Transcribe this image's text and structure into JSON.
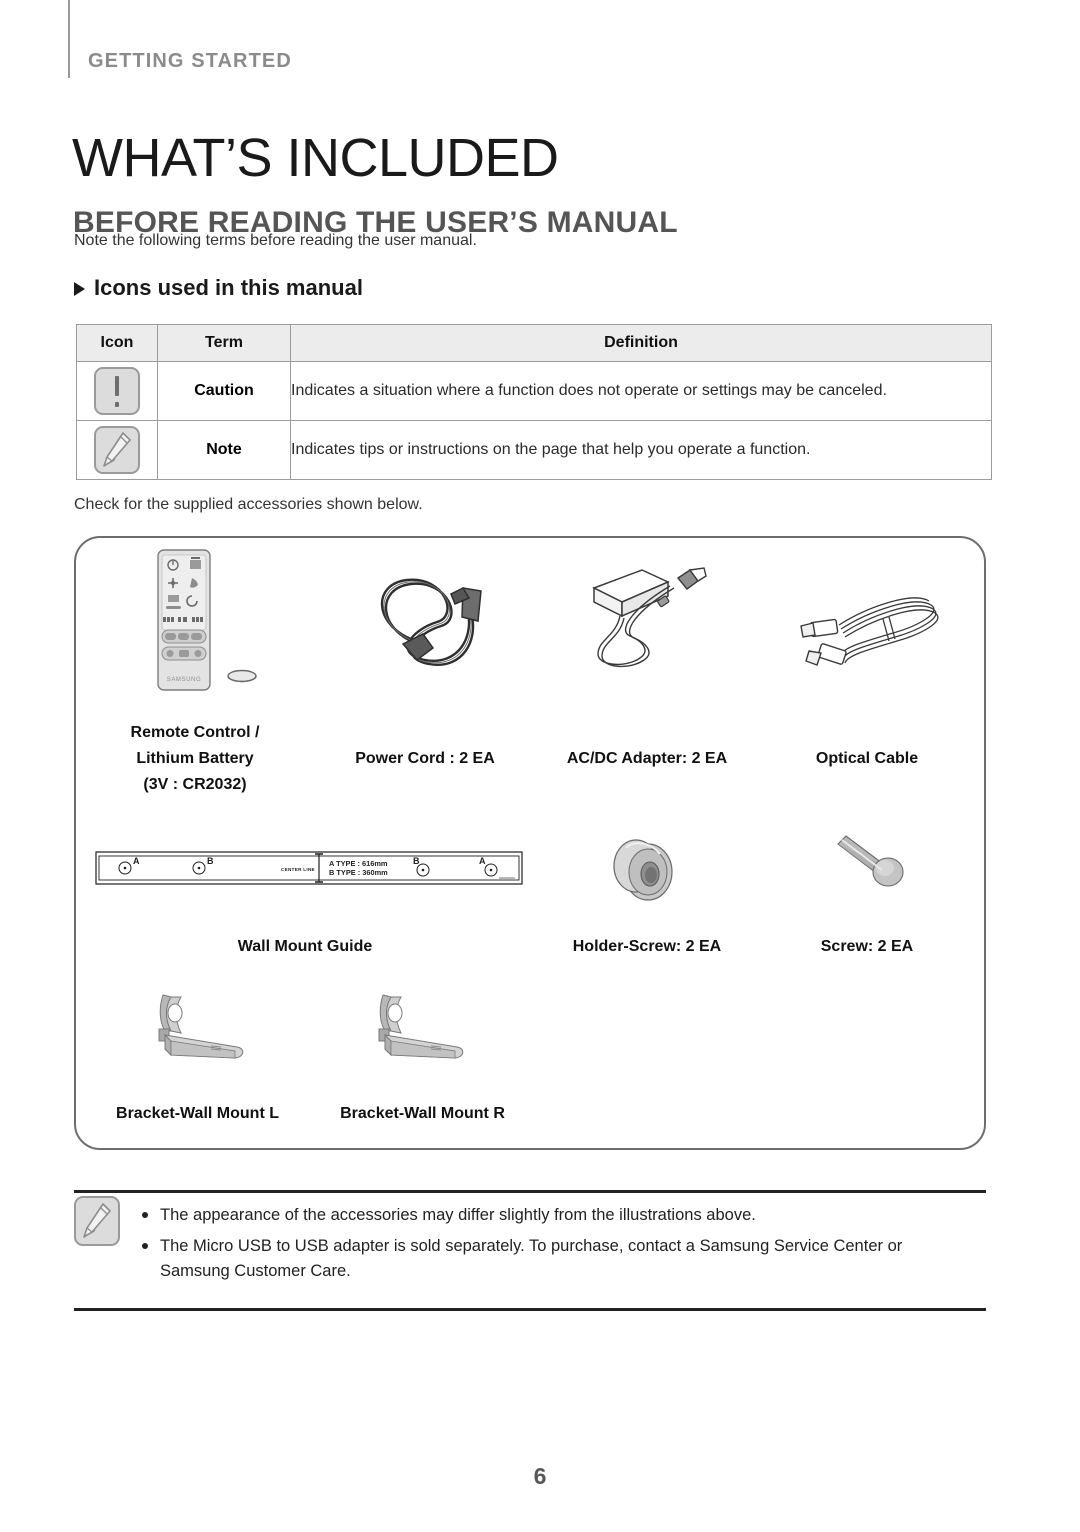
{
  "header": {
    "eyebrow": "GETTING STARTED",
    "title": "WHAT’S INCLUDED",
    "subtitle": "BEFORE READING THE USER’S MANUAL",
    "intro": "Note the following terms before reading the user manual."
  },
  "icons_section": {
    "heading": "Icons used in this manual",
    "table": {
      "columns": [
        "Icon",
        "Term",
        "Definition"
      ],
      "rows": [
        {
          "icon": "caution-icon",
          "term": "Caution",
          "definition": "Indicates a situation where a function does not operate or settings may be canceled."
        },
        {
          "icon": "note-icon",
          "term": "Note",
          "definition": "Indicates tips or instructions on the page that help you operate a function."
        }
      ]
    }
  },
  "accessories": {
    "intro": "Check for the supplied accessories shown below.",
    "items": [
      {
        "caption_lines": [
          "Remote Control /",
          "Lithium Battery",
          "(3V : CR2032)"
        ],
        "art": "remote-control-and-battery"
      },
      {
        "caption_lines": [
          "Power Cord : 2 EA"
        ],
        "art": "power-cord"
      },
      {
        "caption_lines": [
          "AC/DC Adapter: 2 EA"
        ],
        "art": "ac-dc-adapter"
      },
      {
        "caption_lines": [
          "Optical Cable"
        ],
        "art": "optical-cable"
      },
      {
        "caption_lines": [
          "Wall Mount Guide"
        ],
        "art": "wall-mount-guide"
      },
      {
        "caption_lines": [
          "Holder-Screw: 2 EA"
        ],
        "art": "holder-screw"
      },
      {
        "caption_lines": [
          "Screw: 2 EA"
        ],
        "art": "screw"
      },
      {
        "caption_lines": [
          "Bracket-Wall Mount L"
        ],
        "art": "bracket-wall-mount-left"
      },
      {
        "caption_lines": [
          "Bracket-Wall Mount R"
        ],
        "art": "bracket-wall-mount-right"
      }
    ],
    "wall_mount_guide_markings": {
      "hole_labels": [
        "A",
        "B",
        "B",
        "A"
      ],
      "center_line_label": "CENTER LINE",
      "type_lines": [
        "A TYPE : 616mm",
        "B TYPE : 360mm"
      ]
    },
    "remote_brand": "SAMSUNG"
  },
  "notes": [
    "The appearance of the accessories may differ slightly from the illustrations above.",
    "The Micro USB to USB adapter is sold separately. To purchase, contact a Samsung Service Center or Samsung Customer Care."
  ],
  "page_number": "6",
  "colors": {
    "eyebrow": "#8b8b8b",
    "subtitle": "#555555",
    "table_header_bg": "#ececec",
    "rule": "#222222"
  }
}
